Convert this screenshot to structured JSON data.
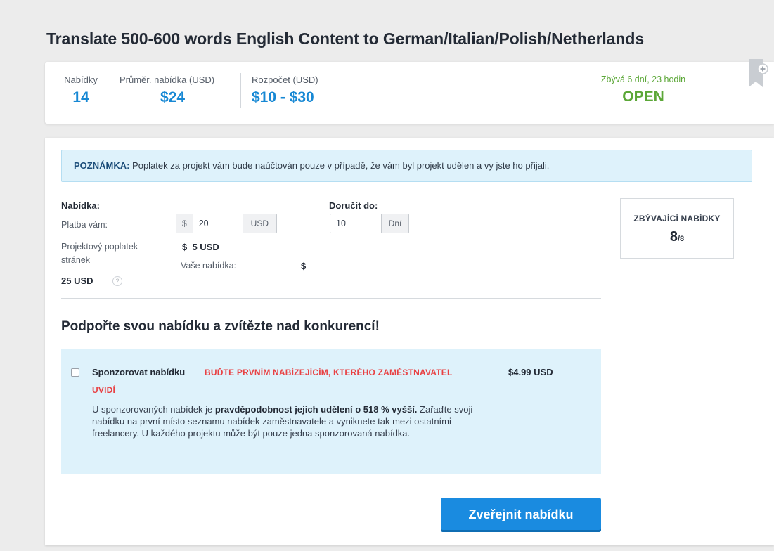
{
  "page": {
    "title": "Translate 500-600 words English Content to German/Italian/Polish/Netherlands"
  },
  "stats": {
    "bids_label": "Nabídky",
    "bids_value": "14",
    "avg_label": "Průměr. nabídka (USD)",
    "avg_value": "$24",
    "budget_label": "Rozpočet (USD)",
    "budget_value": "$10 - $30",
    "time_left": "Zbývá 6 dní, 23 hodin",
    "status": "OPEN",
    "status_color": "#5ba737"
  },
  "note": {
    "label": "POZNÁMKA:",
    "text": " Poplatek za projekt vám bude naúčtován pouze v případě, že vám byl projekt udělen a vy jste ho přijali."
  },
  "bid_form": {
    "bid_heading": "Nabídka:",
    "pay_label": "Platba vám:",
    "pay_currency_symbol": "$",
    "pay_value": "20",
    "pay_currency": "USD",
    "fee_label_line1": "Projektový poplatek",
    "fee_label_line2": "stránek",
    "fee_value": "$  5 USD",
    "site_fee_amount": "25 USD",
    "help_icon_text": "?",
    "your_bid_label": "Vaše nabídka:",
    "your_bid_value": "$",
    "deliver_heading": "Doručit do:",
    "deliver_value": "10",
    "deliver_unit": "Dní"
  },
  "remaining": {
    "label": "ZBÝVAJÍCÍ NABÍDKY",
    "value": "8",
    "total": "/8"
  },
  "promo": {
    "heading": "Podpořte svou nabídku a zvítězte nad konkurencí!"
  },
  "sponsor": {
    "title": "Sponzorovat nabídku",
    "tagline_line1": "BUĎTE PRVNÍM NABÍZEJÍCÍM, KTERÉHO ZAMĚSTNAVATEL",
    "tagline_line2": "UVIDÍ",
    "price": "$4.99 USD",
    "desc_before": "U sponzorovaných nabídek je ",
    "desc_bold": "pravděpodobnost jejich udělení o 518 % vyšší.",
    "desc_after": " Zařaďte svoji nabídku na první místo seznamu nabídek zaměstnavatele a vyniknete tak mezi ostatními freelancery. U každého projektu může být pouze jedna sponzorovaná nabídka.",
    "checked": false
  },
  "actions": {
    "publish_label": "Zveřejnit nabídku",
    "primary_color": "#1a8be0"
  }
}
